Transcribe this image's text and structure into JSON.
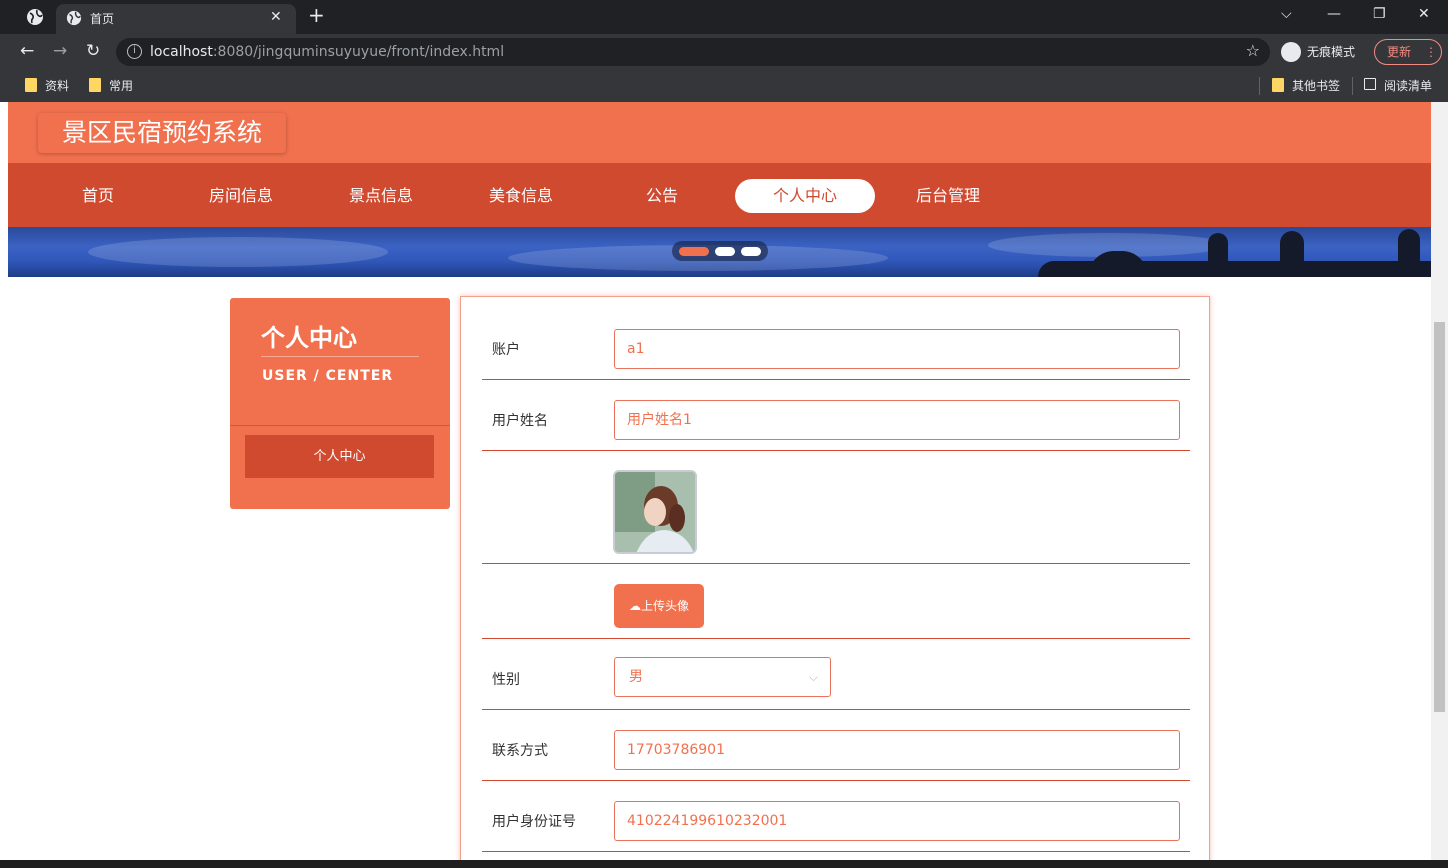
{
  "browser": {
    "tab_title": "首页",
    "url_host": "localhost",
    "url_rest": ":8080/jingquminsuyuyue/front/index.html",
    "incognito_label": "无痕模式",
    "update_label": "更新",
    "bookmarks": [
      "资料",
      "常用"
    ],
    "other_bookmarks": "其他书签",
    "reading_list": "阅读清单"
  },
  "site": {
    "title": "景区民宿预约系统",
    "nav": [
      "首页",
      "房间信息",
      "景点信息",
      "美食信息",
      "公告",
      "个人中心",
      "后台管理"
    ],
    "active_nav": "个人中心"
  },
  "side": {
    "title": "个人中心",
    "subtitle": "USER / CENTER",
    "button": "个人中心"
  },
  "form": {
    "account_label": "账户",
    "account_value": "a1",
    "name_label": "用户姓名",
    "name_value": "用户姓名1",
    "upload_label": "上传头像",
    "gender_label": "性别",
    "gender_value": "男",
    "phone_label": "联系方式",
    "phone_value": "17703786901",
    "idcard_label": "用户身份证号",
    "idcard_value": "410224199610232001"
  },
  "colors": {
    "primary": "#f1714f",
    "primary_dark": "#d04a30"
  }
}
